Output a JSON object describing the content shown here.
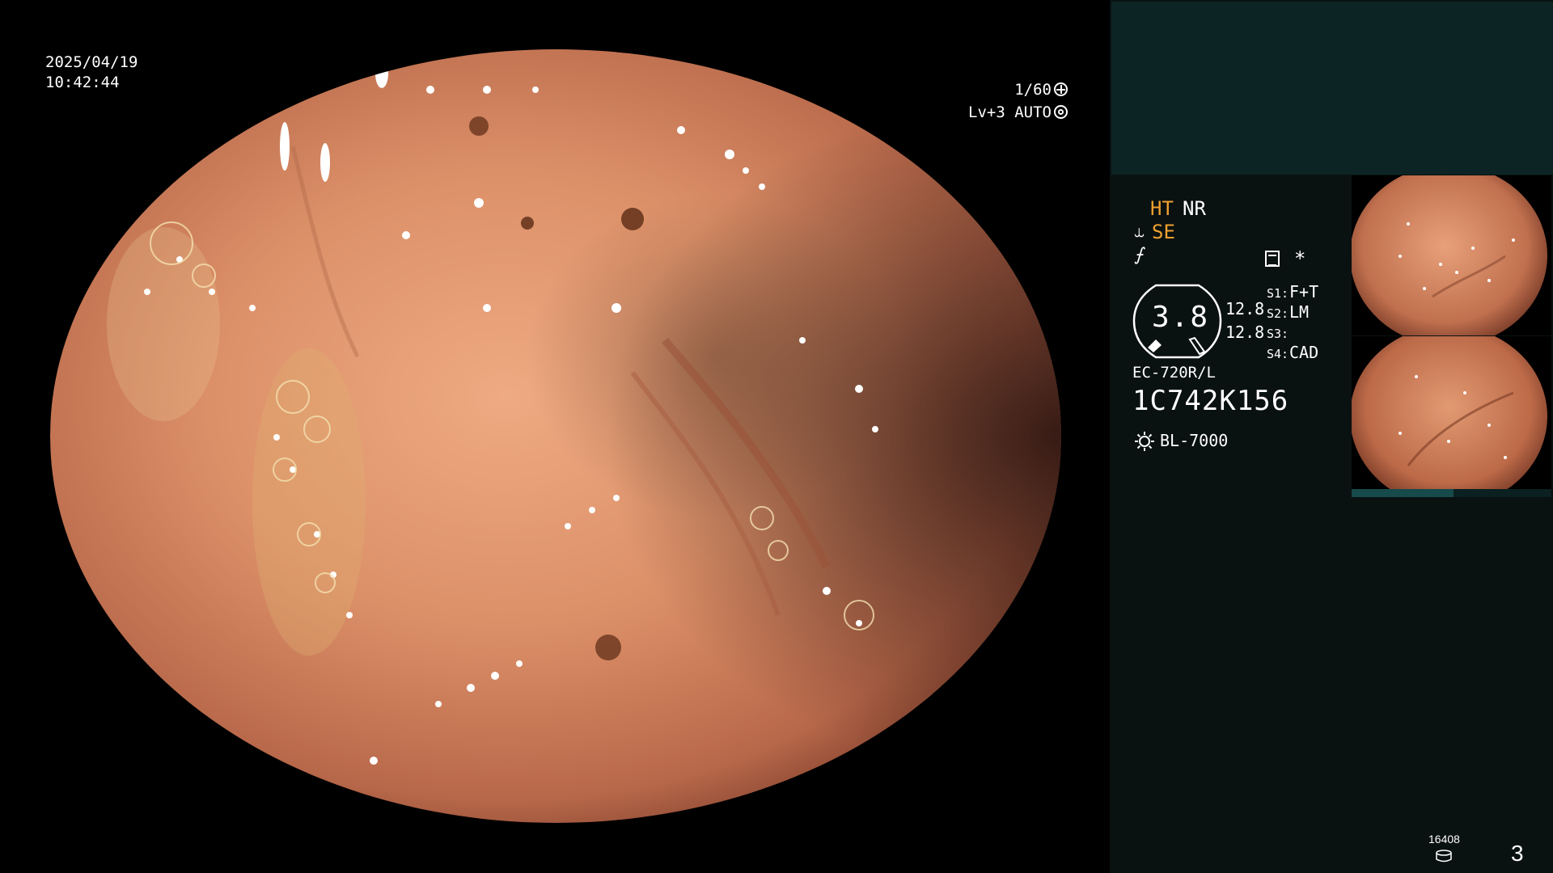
{
  "osd": {
    "date": "2025/04/19",
    "time": "10:42:44",
    "shutter": "1/60",
    "level": "Lv+3 AUTO",
    "shutter_icon": "shutter-icon",
    "iris_icon": "iris-icon"
  },
  "panel": {
    "modes": {
      "ht": "HT",
      "nr": "NR",
      "se": "SE",
      "se_icon_glyph": "⥿",
      "f_icon_glyph": "⨍"
    },
    "asterisk": "*",
    "zoom": {
      "value": "3.8",
      "r1": "12.8",
      "r2": "12.8"
    },
    "slots": [
      {
        "label": "S1:",
        "value": "F+T"
      },
      {
        "label": "S2:",
        "value": "LM"
      },
      {
        "label": "S3:",
        "value": ""
      },
      {
        "label": "S4:",
        "value": "CAD"
      }
    ],
    "scope_model": "EC-720R/L",
    "scope_serial": "1C742K156",
    "light_source": "BL-7000",
    "frame_count": "16408",
    "page_number": "3"
  },
  "colors": {
    "accent_orange": "#f0a030",
    "panel_bg": "#0a1111",
    "panel_header": "#0d2424",
    "mucosa_base": "#d98a64",
    "mucosa_dark": "#6a3020"
  },
  "thumb_bar_progress": 0.51
}
